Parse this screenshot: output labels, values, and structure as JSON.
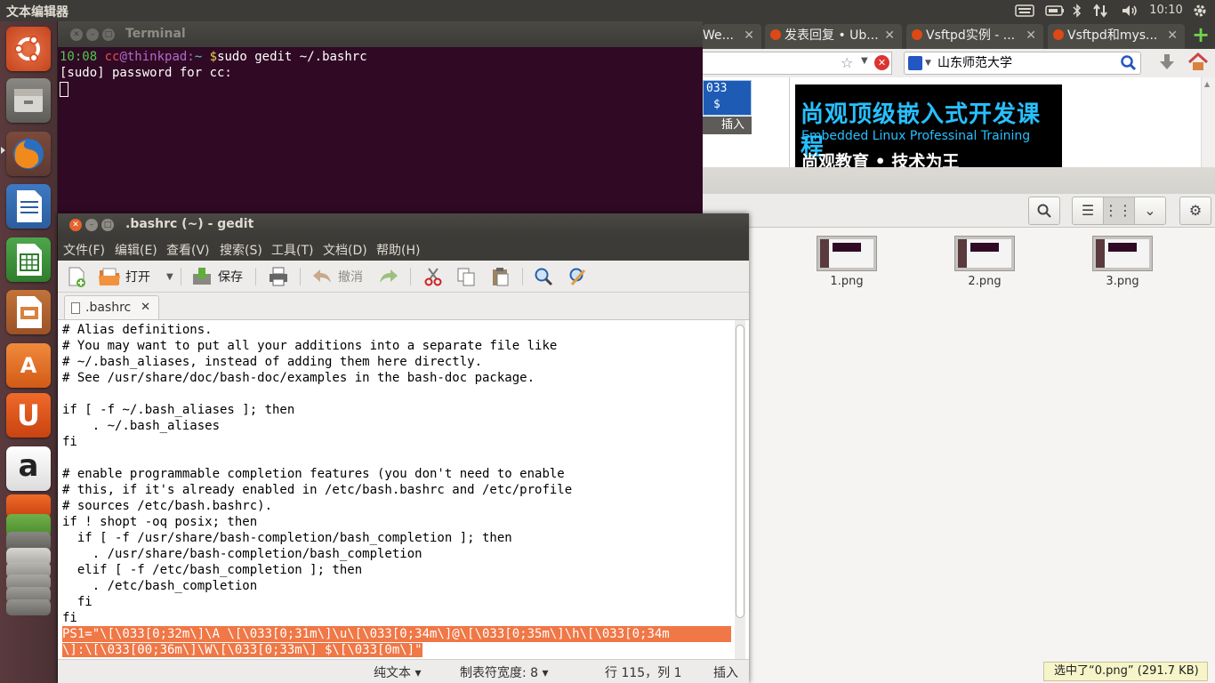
{
  "top_panel": {
    "app_title": "文本编辑器",
    "time": "10:10",
    "indicators": [
      "keyboard-icon",
      "battery-icon",
      "bluetooth-icon",
      "network-icon",
      "volume-icon",
      "gear-icon"
    ]
  },
  "launcher": {
    "items": [
      "ubuntu-logo-icon",
      "files-icon",
      "firefox-icon",
      "writer-icon",
      "calc-icon",
      "impress-icon",
      "software-center-icon",
      "ubuntu-one-icon",
      "amazon-icon"
    ],
    "amazon_glyph": "a",
    "software_glyph": "A",
    "u1_glyph": "U"
  },
  "terminal": {
    "title": "Terminal",
    "prompt_time": "10:08",
    "prompt_user": "cc",
    "prompt_at_host": "@thinkpad:",
    "prompt_path": "~",
    "prompt_symbol": "$",
    "command": "sudo gedit ~/.bashrc",
    "line2": "[sudo] password for cc:"
  },
  "firefox": {
    "tabs": [
      {
        "label": "We..."
      },
      {
        "label": "发表回复 • Ub..."
      },
      {
        "label": "Vsftpd实例 - ..."
      },
      {
        "label": "Vsftpd和mys..."
      }
    ],
    "new_tab": "+",
    "search_text": "山东师范大学",
    "term_snippet": [
      "033",
      "$",
      "插入"
    ],
    "banner": {
      "line1": "尚观顶级嵌入式开发课程",
      "line2": "Embedded Linux Professinal Training",
      "line3": "尚观教育 • 技术为王"
    }
  },
  "nautilus": {
    "files": [
      {
        "name": "1.png"
      },
      {
        "name": "2.png"
      },
      {
        "name": "3.png"
      }
    ],
    "status": "选中了“0.png” (291.7 KB)"
  },
  "gedit": {
    "title": ".bashrc (~) - gedit",
    "menus": [
      "文件(F)",
      "编辑(E)",
      "查看(V)",
      "搜索(S)",
      "工具(T)",
      "文档(D)",
      "帮助(H)"
    ],
    "toolbar": {
      "open": "打开",
      "save": "保存",
      "undo": "撤消"
    },
    "tab_label": ".bashrc",
    "code_lines": [
      "# Alias definitions.",
      "# You may want to put all your additions into a separate file like",
      "# ~/.bash_aliases, instead of adding them here directly.",
      "# See /usr/share/doc/bash-doc/examples in the bash-doc package.",
      "",
      "if [ -f ~/.bash_aliases ]; then",
      "    . ~/.bash_aliases",
      "fi",
      "",
      "# enable programmable completion features (you don't need to enable",
      "# this, if it's already enabled in /etc/bash.bashrc and /etc/profile",
      "# sources /etc/bash.bashrc).",
      "if ! shopt -oq posix; then",
      "  if [ -f /usr/share/bash-completion/bash_completion ]; then",
      "    . /usr/share/bash-completion/bash_completion",
      "  elif [ -f /etc/bash_completion ]; then",
      "    . /etc/bash_completion",
      "  fi",
      "fi"
    ],
    "selected_lines": [
      "PS1=\"\\[\\033[0;32m\\]\\A \\[\\033[0;31m\\]\\u\\[\\033[0;34m\\]@\\[\\033[0;35m\\]\\h\\[\\033[0;34m",
      "\\]:\\[\\033[00;36m\\]\\W\\[\\033[0;33m\\] $\\[\\033[0m\\]\""
    ],
    "status": {
      "language": "纯文本 ▾",
      "tab_width": "制表符宽度: 8 ▾",
      "position": "行 115，列 1",
      "mode": "插入"
    }
  }
}
